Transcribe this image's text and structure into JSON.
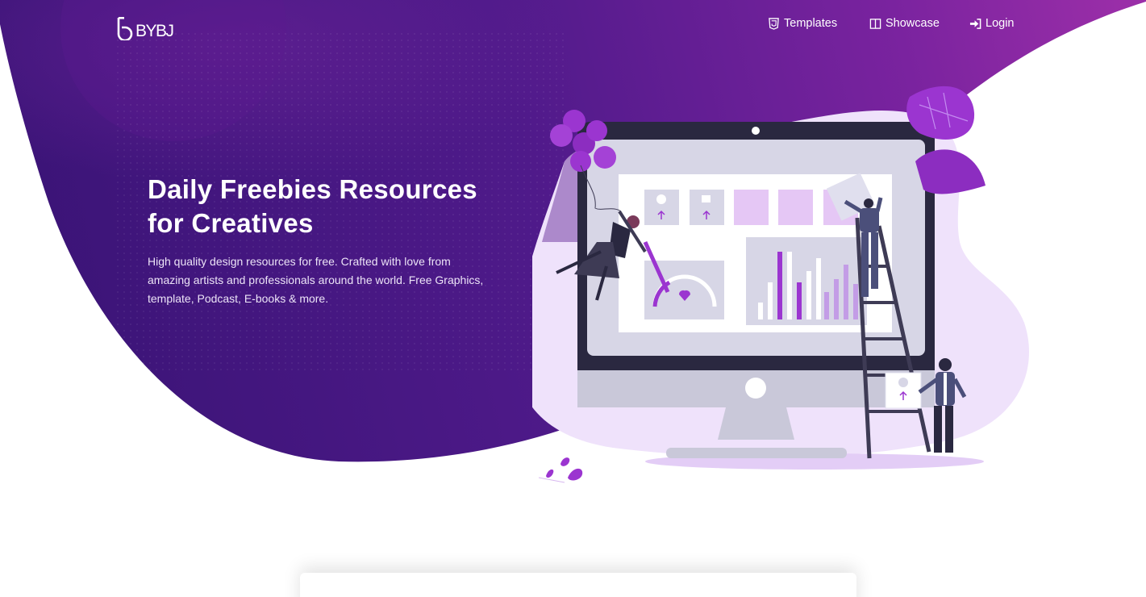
{
  "brand": {
    "logo_text": "BYBJ"
  },
  "nav": {
    "items": [
      {
        "label": "Templates",
        "icon": "html5-shield-icon"
      },
      {
        "label": "Showcase",
        "icon": "book-columns-icon"
      },
      {
        "label": "Login",
        "icon": "sign-in-icon"
      }
    ]
  },
  "hero": {
    "title": "Daily Freebies Resources for Creatives",
    "description": "High quality design resources for free. Crafted with love from amazing artists and professionals around the world. Free Graphics, template, Podcast, E-books & more."
  },
  "colors": {
    "brand_deep": "#3a1574",
    "brand_mid": "#5a1d91",
    "brand_light": "#8e2aa6",
    "accent": "#9b35d0",
    "white": "#ffffff"
  }
}
